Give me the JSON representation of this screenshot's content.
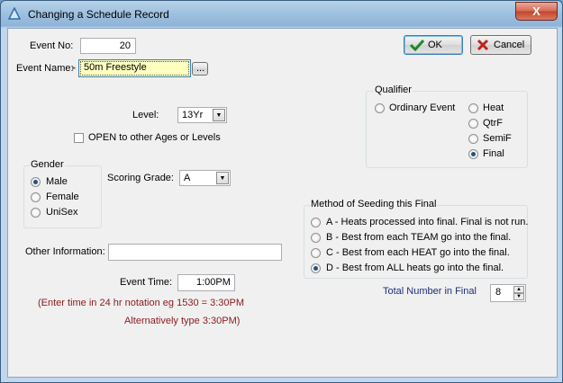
{
  "window": {
    "title": "Changing a Schedule Record",
    "close_glyph": "X"
  },
  "buttons": {
    "ok": "OK",
    "cancel": "Cancel",
    "browse": "..."
  },
  "event_no": {
    "label": "Event No:",
    "value": "20"
  },
  "event_name": {
    "label": "Event Name:",
    "value": "50m Freestyle"
  },
  "level": {
    "label": "Level:",
    "value": "13Yr"
  },
  "open_check": {
    "label": "OPEN to other Ages or Levels",
    "checked": false
  },
  "gender": {
    "title": "Gender",
    "options": [
      "Male",
      "Female",
      "UniSex"
    ],
    "selected": "Male"
  },
  "scoring": {
    "label": "Scoring Grade:",
    "value": "A"
  },
  "qualifier": {
    "title": "Qualifier",
    "options": [
      "Ordinary Event",
      "Heat",
      "QtrF",
      "SemiF",
      "Final"
    ],
    "selected": "Final"
  },
  "seeding": {
    "title": "Method of Seeding this Final",
    "options": [
      "A - Heats processed into final. Final is not run.",
      "B - Best from each TEAM go into the final.",
      "C - Best from each HEAT go into the final.",
      "D - Best from ALL heats go into the final."
    ],
    "selected": "D - Best from ALL heats go into the final."
  },
  "other_info": {
    "label": "Other Information:",
    "value": ""
  },
  "event_time": {
    "label": "Event Time:",
    "value": "1:00PM",
    "hint1": "(Enter time in 24 hr notation eg 1530 = 3:30PM",
    "hint2": "Alternatively type 3:30PM)"
  },
  "total_final": {
    "label": "Total Number in Final",
    "value": "8"
  },
  "icons": {
    "title": "app-triangle-icon",
    "ok": "check-icon",
    "cancel": "x-icon"
  },
  "colors": {
    "hint_text": "#8b1a1a",
    "total_label": "#1f2e7a",
    "name_field_bg": "#ffffc0"
  }
}
